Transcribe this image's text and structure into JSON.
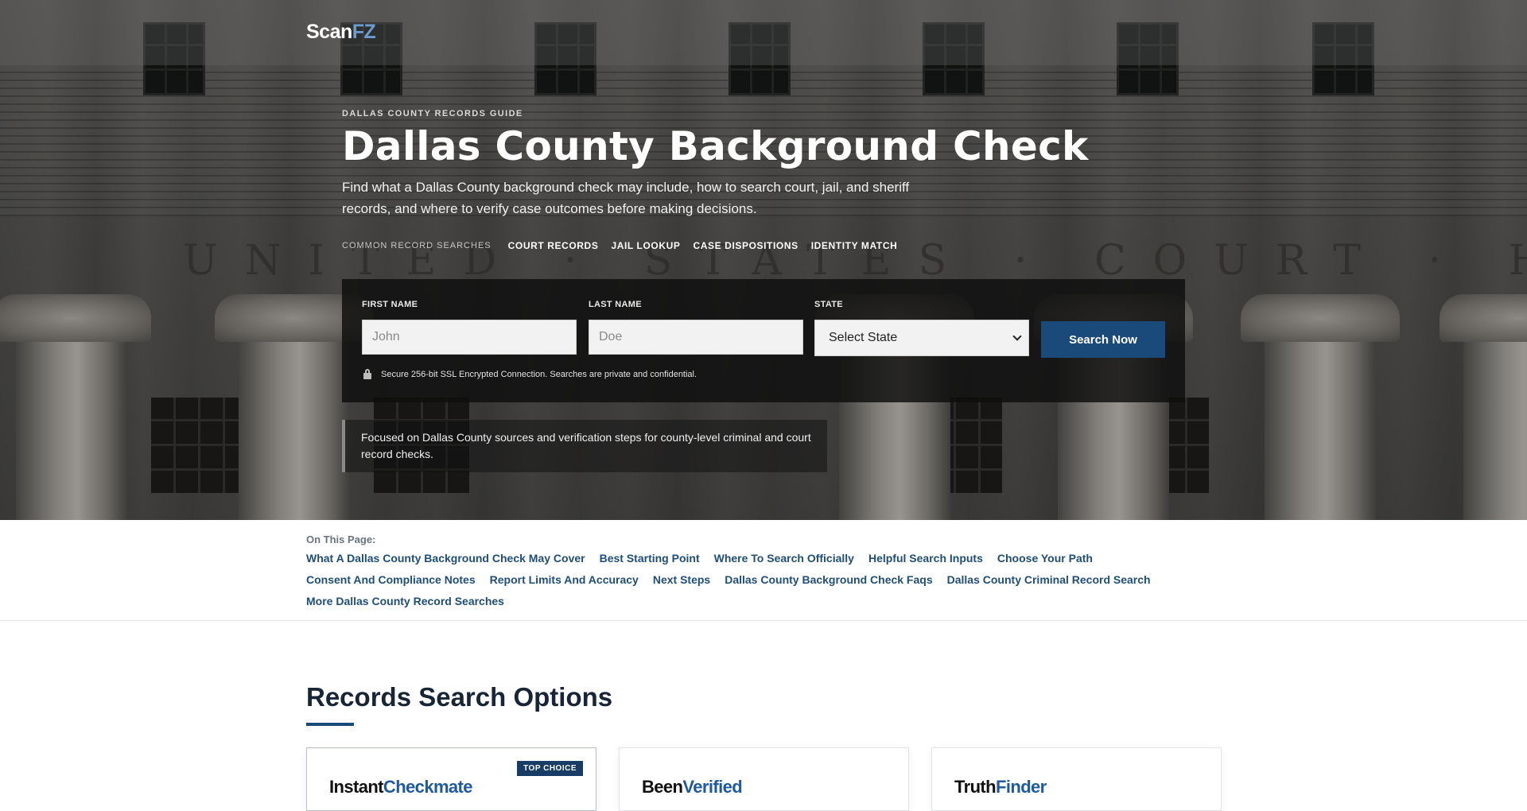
{
  "brand": {
    "name_part1": "Scan",
    "name_part2": "FZ"
  },
  "hero": {
    "eyebrow": "DALLAS COUNTY RECORDS GUIDE",
    "title": "Dallas County Background Check",
    "lede": "Find what a Dallas County background check may include, how to search court, jail, and sheriff records, and where to verify case outcomes before making decisions.",
    "inscription": "UNITED · STATES · COURT · HOUSE ·",
    "common_label": "COMMON RECORD SEARCHES",
    "common_links": [
      "COURT RECORDS",
      "JAIL LOOKUP",
      "CASE DISPOSITIONS",
      "IDENTITY MATCH"
    ]
  },
  "search_form": {
    "first_name_label": "FIRST NAME",
    "first_name_placeholder": "John",
    "last_name_label": "LAST NAME",
    "last_name_placeholder": "Doe",
    "state_label": "STATE",
    "state_selected": "Select State",
    "button_label": "Search Now",
    "secure_text": "Secure 256-bit SSL Encrypted Connection. Searches are private and confidential."
  },
  "note": "Focused on Dallas County sources and verification steps for county-level criminal and court record checks.",
  "toc": {
    "label": "On This Page:",
    "rows": [
      [
        "What A Dallas County Background Check May Cover",
        "Best Starting Point",
        "Where To Search Officially",
        "Helpful Search Inputs",
        "Choose Your Path"
      ],
      [
        "Consent And Compliance Notes",
        "Report Limits And Accuracy",
        "Next Steps",
        "Dallas County Background Check Faqs",
        "Dallas County Criminal Record Search"
      ],
      [
        "More Dallas County Record Searches"
      ]
    ]
  },
  "section": {
    "title": "Records Search Options",
    "cards": [
      {
        "name_part1": "Instant",
        "name_part2": "Checkmate",
        "badge": "TOP CHOICE"
      },
      {
        "name_part1": "Been",
        "name_part2": "Verified",
        "badge": ""
      },
      {
        "name_part1": "Truth",
        "name_part2": "Finder",
        "badge": ""
      }
    ]
  },
  "colors": {
    "accent": "#1a4a7a",
    "link": "#1f4e79",
    "logo_accent": "#6b9bd1"
  },
  "icons": {
    "secure": "lock-icon",
    "select": "chevron-down-icon"
  }
}
